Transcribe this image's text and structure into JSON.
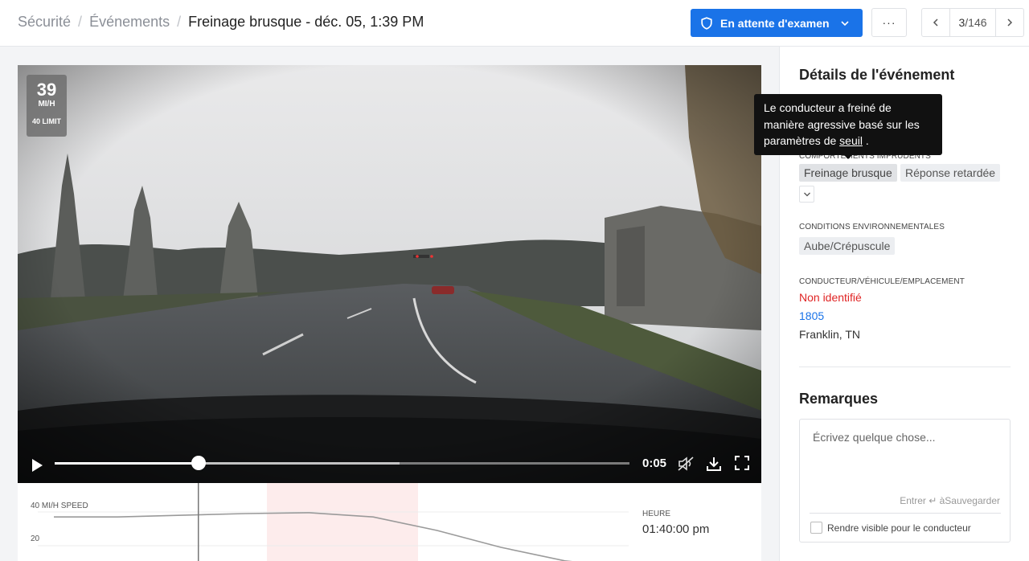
{
  "breadcrumb": {
    "items": [
      "Sécurité",
      "Événements"
    ],
    "current": "Freinage brusque - déc. 05, 1:39 PM"
  },
  "status_button": {
    "label": "En attente d'examen",
    "icon": "shield-icon",
    "color": "#1a73e8"
  },
  "more_button": {
    "label": "···"
  },
  "pager": {
    "current": "3",
    "total": "146"
  },
  "video": {
    "speed_value": "39",
    "speed_unit": "MI/H",
    "speed_limit": "40 LIMIT",
    "time": "0:05",
    "progress": 0.25
  },
  "speed_chart": {
    "axis_label_top": "40 MI/H SPEED",
    "axis_label_mid": "20",
    "time_label": "HEURE",
    "time_value": "01:40:00 pm"
  },
  "chart_data": {
    "type": "line",
    "ylabel": "MI/H SPEED",
    "yticks": [
      20,
      40
    ],
    "series": [
      {
        "values": [
          38,
          38,
          39,
          40,
          40.5,
          38,
          30,
          20,
          12,
          8
        ]
      }
    ]
  },
  "details": {
    "title": "Détails de l'événement",
    "tooltip": {
      "text_before": "Le conducteur a freiné de manière agressive basé sur les paramètres de ",
      "link": "seuil",
      "text_after": " ."
    },
    "behaviors_label": "COMPORTEMENTS IMPRUDENTS",
    "behaviors": [
      "Freinage brusque",
      "Réponse retardée"
    ],
    "env_label": "CONDITIONS ENVIRONNEMENTALES",
    "env": [
      "Aube/Crépuscule"
    ],
    "dve_label": "CONDUCTEUR/VÉHICULE/EMPLACEMENT",
    "driver": "Non identifié",
    "vehicle": "1805",
    "location": "Franklin, TN",
    "colors": {
      "driver": "#e02424",
      "vehicle": "#1a73e8"
    }
  },
  "remarks": {
    "title": "Remarques",
    "placeholder": "Écrivez quelque chose...",
    "hint": "Entrer ↵ àSauvegarder",
    "checkbox_label": "Rendre visible pour le conducteur"
  }
}
